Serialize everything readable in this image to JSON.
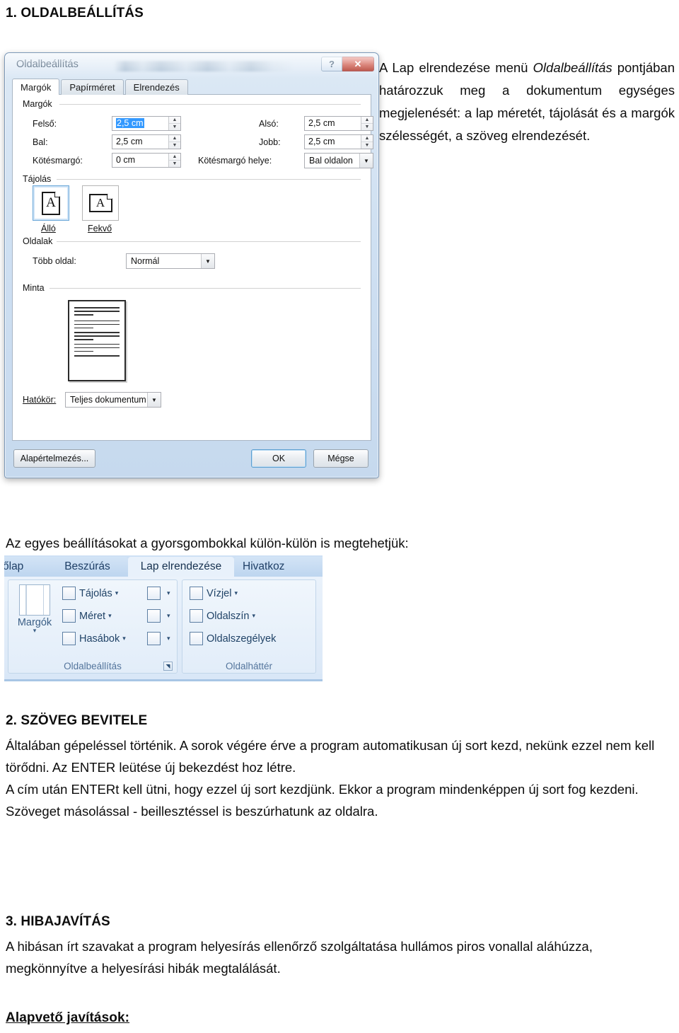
{
  "document": {
    "heading1": "1. OLDALBEÁLLÍTÁS",
    "intro_paragraph": {
      "part1": " A Lap elrendezése menü ",
      "italic": "Oldalbeállítás",
      "part2": " pontjában határozzuk meg a dokumentum egységes    megjelenését: a lap méretét, tájolását és a margók szélességét, a szöveg elrendezését."
    },
    "caption_line": "Az egyes beállításokat a gyorsgombokkal külön-külön is megtehetjük:",
    "section2": {
      "heading": "2. SZÖVEG BEVITELE",
      "paragraph": "Általában gépeléssel történik. A sorok végére érve a program automatikusan új sort kezd, nekünk ezzel nem kell törődni. Az ENTER leütése új bekezdést hoz létre.\nA cím után ENTERt kell ütni, hogy ezzel új sort kezdjünk. Ekkor a program mindenképpen új sort fog kezdeni.\nSzöveget másolással - beillesztéssel is beszúrhatunk az oldalra."
    },
    "section3": {
      "heading": "3. HIBAJAVÍTÁS",
      "paragraph": " A hibásan írt szavakat a program helyesírás ellenőrző szolgáltatása hullámos piros vonallal aláhúzza,  megkönnyítve a helyesírási hibák megtalálását."
    },
    "section4": {
      "heading": "Alapvető javítások:"
    }
  },
  "dialog": {
    "title": "Oldalbeállítás",
    "help_glyph": "?",
    "close_glyph": "✕",
    "tabs": [
      {
        "label": "Margók",
        "active": true
      },
      {
        "label": "Papírméret",
        "active": false
      },
      {
        "label": "Elrendezés",
        "active": false
      }
    ],
    "groups": {
      "margins_label": "Margók",
      "orientation_label": "Tájolás",
      "pages_label": "Oldalak",
      "preview_label": "Minta"
    },
    "fields": {
      "top_label": "Felső:",
      "top_value": "2,5 cm",
      "bottom_label": "Alsó:",
      "bottom_value": "2,5 cm",
      "left_label": "Bal:",
      "left_value": "2,5 cm",
      "right_label": "Jobb:",
      "right_value": "2,5 cm",
      "gutter_label": "Kötésmargó:",
      "gutter_value": "0 cm",
      "gutter_pos_label": "Kötésmargó helye:",
      "gutter_pos_value": "Bal oldalon",
      "multipage_label": "Több oldal:",
      "multipage_value": "Normál",
      "scope_label": "Hatókör:",
      "scope_value": "Teljes dokumentum"
    },
    "orientation": {
      "portrait_label": "Álló",
      "landscape_label": "Fekvő",
      "glyph": "A",
      "selected": "portrait"
    },
    "buttons": {
      "default": "Alapértelmezés...",
      "ok": "OK",
      "cancel": "Mégse"
    }
  },
  "ribbon": {
    "tabs": [
      {
        "label": "őlap",
        "active": false
      },
      {
        "label": "Beszúrás",
        "active": false
      },
      {
        "label": "Lap elrendezése",
        "active": true
      },
      {
        "label": "Hivatkoz",
        "active": false
      }
    ],
    "group1": {
      "label": "Oldalbeállítás",
      "big_button": "Margók",
      "items": [
        "Tájolás",
        "Méret",
        "Hasábok"
      ]
    },
    "group2": {
      "label": "Oldalháttér",
      "items": [
        "Vízjel",
        "Oldalszín",
        "Oldalszegélyek"
      ]
    },
    "caret": "▾"
  },
  "colors": {
    "accent_blue": "#3399ff",
    "dialog_chrome": "#cfe0f2",
    "close_red": "#c23524",
    "ribbon_blue": "#d9e7f7",
    "ribbon_text": "#1f4266"
  }
}
